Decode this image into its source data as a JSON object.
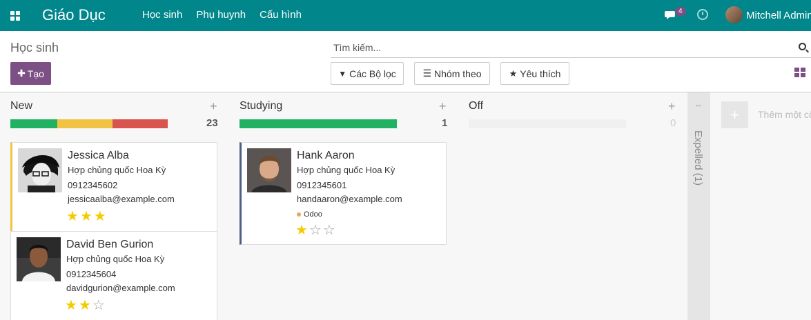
{
  "nav": {
    "brand": "Giáo Dục",
    "menu": [
      "Học sinh",
      "Phụ huynh",
      "Cấu hình"
    ],
    "chat_count": "4",
    "user": "Mitchell Admin"
  },
  "control": {
    "title": "Học sinh",
    "create_label": "Tạo",
    "search_placeholder": "Tìm kiếm...",
    "filter_label": "Các Bộ lọc",
    "group_label": "Nhóm theo",
    "fav_label": "Yêu thích"
  },
  "colors": {
    "navbar": "#00868b",
    "primary": "#7c4f85",
    "green": "#21b163",
    "yellow": "#f0c342",
    "red": "#d9534f"
  },
  "columns": [
    {
      "title": "New",
      "count": "23",
      "progress": {
        "green": 0.3,
        "yellow": 0.35,
        "red": 0.35
      }
    },
    {
      "title": "Studying",
      "count": "1",
      "progress": {
        "green": 1.0,
        "yellow": 0,
        "red": 0
      }
    },
    {
      "title": "Off",
      "count": "0",
      "progress": {
        "green": 0,
        "yellow": 0,
        "red": 0
      }
    }
  ],
  "folded_column": {
    "label": "Expelled (1)"
  },
  "add_column_text": "Thêm một cột",
  "cards": [
    {
      "name": "Jessica Alba",
      "country": "Hợp chủng quốc Hoa Kỳ",
      "phone": "0912345602",
      "email": "jessicaalba@example.com",
      "stars": 3,
      "tag": ""
    },
    {
      "name": "David Ben Gurion",
      "country": "Hợp chủng quốc Hoa Kỳ",
      "phone": "0912345604",
      "email": "davidgurion@example.com",
      "stars": 2,
      "tag": ""
    },
    {
      "name": "Hank Aaron",
      "country": "Hợp chủng quốc Hoa Kỳ",
      "phone": "0912345601",
      "email": "handaaron@example.com",
      "stars": 1,
      "tag": "Odoo"
    }
  ]
}
